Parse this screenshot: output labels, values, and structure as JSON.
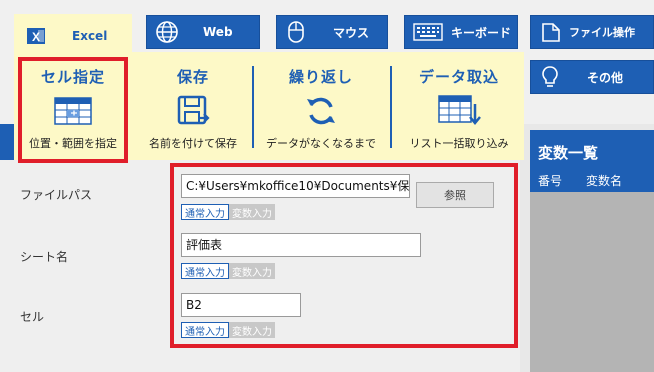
{
  "tabs": {
    "excel": "Excel",
    "web": "Web",
    "mouse": "マウス",
    "keyboard": "キーボード",
    "file": "ファイル操作",
    "other": "その他"
  },
  "dropdown": {
    "cell": {
      "title": "セル指定",
      "label": "位置・範囲を指定"
    },
    "save": {
      "title": "保存",
      "label": "名前を付けて保存"
    },
    "loop": {
      "title": "繰り返し",
      "label": "データがなくなるまで"
    },
    "import": {
      "title": "データ取込",
      "label": "リスト一括取り込み"
    }
  },
  "form": {
    "filepath": {
      "label": "ファイルパス",
      "value": "C:¥Users¥mkoffice10¥Documents¥保",
      "browse": "参照"
    },
    "sheet": {
      "label": "シート名",
      "value": "評価表"
    },
    "cell": {
      "label": "セル",
      "value": "B2"
    },
    "mode_normal": "通常入力",
    "mode_var": "変数入力"
  },
  "right_panel": {
    "title": "変数一覧",
    "col_no": "番号",
    "col_name": "変数名"
  },
  "colors": {
    "accent": "#1e5fb4",
    "highlight": "#e01e2a",
    "menu_bg": "#fdf9c7"
  }
}
